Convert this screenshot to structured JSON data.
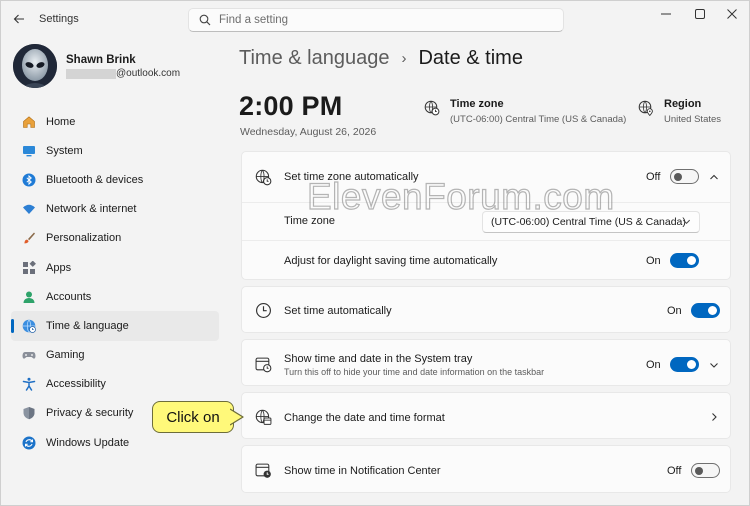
{
  "window": {
    "app_title": "Settings",
    "back_icon": "back-arrow-icon",
    "controls": [
      "minimize-icon",
      "maximize-icon",
      "close-icon"
    ]
  },
  "search": {
    "placeholder": "Find a setting",
    "value": ""
  },
  "profile": {
    "name": "Shawn Brink",
    "email_suffix": "@outlook.com"
  },
  "sidebar": {
    "items": [
      {
        "label": "Home",
        "icon": "home-icon",
        "active": false
      },
      {
        "label": "System",
        "icon": "system-icon",
        "active": false
      },
      {
        "label": "Bluetooth & devices",
        "icon": "bluetooth-icon",
        "active": false
      },
      {
        "label": "Network & internet",
        "icon": "wifi-icon",
        "active": false
      },
      {
        "label": "Personalization",
        "icon": "brush-icon",
        "active": false
      },
      {
        "label": "Apps",
        "icon": "apps-icon",
        "active": false
      },
      {
        "label": "Accounts",
        "icon": "accounts-icon",
        "active": false
      },
      {
        "label": "Time & language",
        "icon": "globe-clock-icon",
        "active": true
      },
      {
        "label": "Gaming",
        "icon": "gamepad-icon",
        "active": false
      },
      {
        "label": "Accessibility",
        "icon": "accessibility-icon",
        "active": false
      },
      {
        "label": "Privacy & security",
        "icon": "shield-icon",
        "active": false
      },
      {
        "label": "Windows Update",
        "icon": "update-icon",
        "active": false
      }
    ]
  },
  "breadcrumb": {
    "parent": "Time & language",
    "separator": "›",
    "current": "Date & time"
  },
  "clock": {
    "time": "2:00 PM",
    "date": "Wednesday, August 26, 2026"
  },
  "timezone_info": {
    "title": "Time zone",
    "value": "(UTC-06:00) Central Time (US & Canada)"
  },
  "region_info": {
    "title": "Region",
    "value": "United States"
  },
  "settings": {
    "set_tz_auto": {
      "label": "Set time zone automatically",
      "state": "Off"
    },
    "time_zone": {
      "label": "Time zone",
      "value": "(UTC-06:00) Central Time (US & Canada)"
    },
    "dst": {
      "label": "Adjust for daylight saving time automatically",
      "state": "On"
    },
    "set_time_auto": {
      "label": "Set time automatically",
      "state": "On"
    },
    "show_tray": {
      "label": "Show time and date in the System tray",
      "description": "Turn this off to hide your time and date information on the taskbar",
      "state": "On"
    },
    "change_format": {
      "label": "Change the date and time format"
    },
    "notif_center": {
      "label": "Show time in Notification Center",
      "state": "Off"
    }
  },
  "watermark": "ElevenForum.com",
  "callout": {
    "text": "Click on"
  },
  "colors": {
    "accent": "#0067c0",
    "callout_fill": "#fff97a"
  }
}
